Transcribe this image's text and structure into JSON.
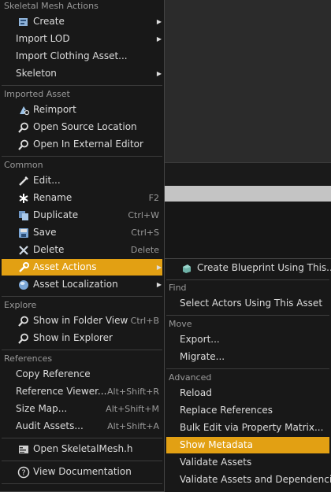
{
  "main_menu": {
    "sections": {
      "skeletal_mesh_actions": "Skeletal Mesh Actions",
      "imported_asset": "Imported Asset",
      "common": "Common",
      "explore": "Explore",
      "references": "References"
    },
    "items": {
      "create": "Create",
      "import_lod": "Import LOD",
      "import_clothing": "Import Clothing Asset...",
      "skeleton": "Skeleton",
      "reimport": "Reimport",
      "open_source_location": "Open Source Location",
      "open_external_editor": "Open In External Editor",
      "edit": "Edit...",
      "rename": "Rename",
      "rename_shortcut": "F2",
      "duplicate": "Duplicate",
      "duplicate_shortcut": "Ctrl+W",
      "save": "Save",
      "save_shortcut": "Ctrl+S",
      "delete": "Delete",
      "delete_shortcut": "Delete",
      "asset_actions": "Asset Actions",
      "asset_localization": "Asset Localization",
      "show_in_folder_view": "Show in Folder View",
      "show_in_folder_view_shortcut": "Ctrl+B",
      "show_in_explorer": "Show in Explorer",
      "copy_reference": "Copy Reference",
      "reference_viewer": "Reference Viewer...",
      "reference_viewer_shortcut": "Alt+Shift+R",
      "size_map": "Size Map...",
      "size_map_shortcut": "Alt+Shift+M",
      "audit_assets": "Audit Assets...",
      "audit_assets_shortcut": "Alt+Shift+A",
      "open_header": "Open SkeletalMesh.h",
      "view_documentation": "View Documentation"
    }
  },
  "sub_menu": {
    "sections": {
      "find": "Find",
      "move": "Move",
      "advanced": "Advanced"
    },
    "items": {
      "create_blueprint": "Create Blueprint Using This...",
      "select_actors": "Select Actors Using This Asset",
      "export": "Export...",
      "migrate": "Migrate...",
      "reload": "Reload",
      "replace_references": "Replace References",
      "bulk_edit": "Bulk Edit via Property Matrix...",
      "show_metadata": "Show Metadata",
      "validate_assets": "Validate Assets",
      "validate_dependencies": "Validate Assets and Dependencies"
    }
  },
  "colors": {
    "highlight": "#e2a013",
    "menu_bg": "#181818",
    "section_text": "#9a9a9a"
  }
}
